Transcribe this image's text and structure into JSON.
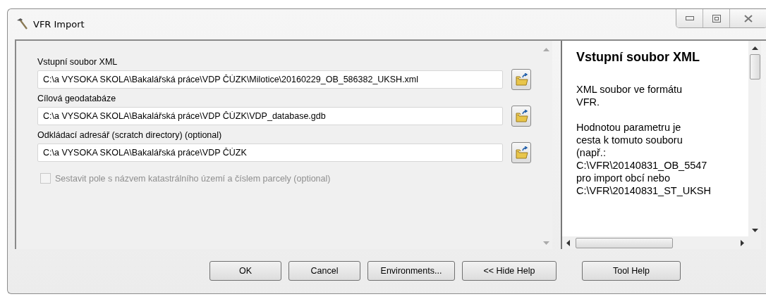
{
  "window": {
    "title": "VFR Import"
  },
  "parameters": [
    {
      "kind": "file",
      "label": "Vstupní soubor XML",
      "value": "C:\\a VYSOKA SKOLA\\Bakalářská práce\\VDP ČÚZK\\Milotice\\20160229_OB_586382_UKSH.xml"
    },
    {
      "kind": "file",
      "label": "Cílová geodatabáze",
      "value": "C:\\a VYSOKA SKOLA\\Bakalářská práce\\VDP ČÚZK\\VDP_database.gdb"
    },
    {
      "kind": "file",
      "label": "Odkládací adresář (scratch directory) (optional)",
      "value": "C:\\a VYSOKA SKOLA\\Bakalářská práce\\VDP ČÚZK"
    },
    {
      "kind": "checkbox",
      "label": "Sestavit pole s názvem katastrálního území a číslem parcely (optional)",
      "checked": false,
      "disabled": true
    }
  ],
  "help": {
    "title": "Vstupní soubor XML",
    "paragraphs": [
      [
        "XML soubor ve formátu",
        "VFR."
      ],
      [
        "Hodnotou parametru je",
        "cesta k tomuto souboru",
        "(např.:",
        "C:\\VFR\\20140831_OB_5547",
        "pro import obcí nebo",
        "C:\\VFR\\20140831_ST_UKSH"
      ]
    ]
  },
  "buttons": [
    {
      "label": "OK"
    },
    {
      "label": "Cancel"
    },
    {
      "label": "Environments..."
    },
    {
      "label": "<< Hide Help"
    },
    {
      "label": "Tool Help"
    }
  ]
}
